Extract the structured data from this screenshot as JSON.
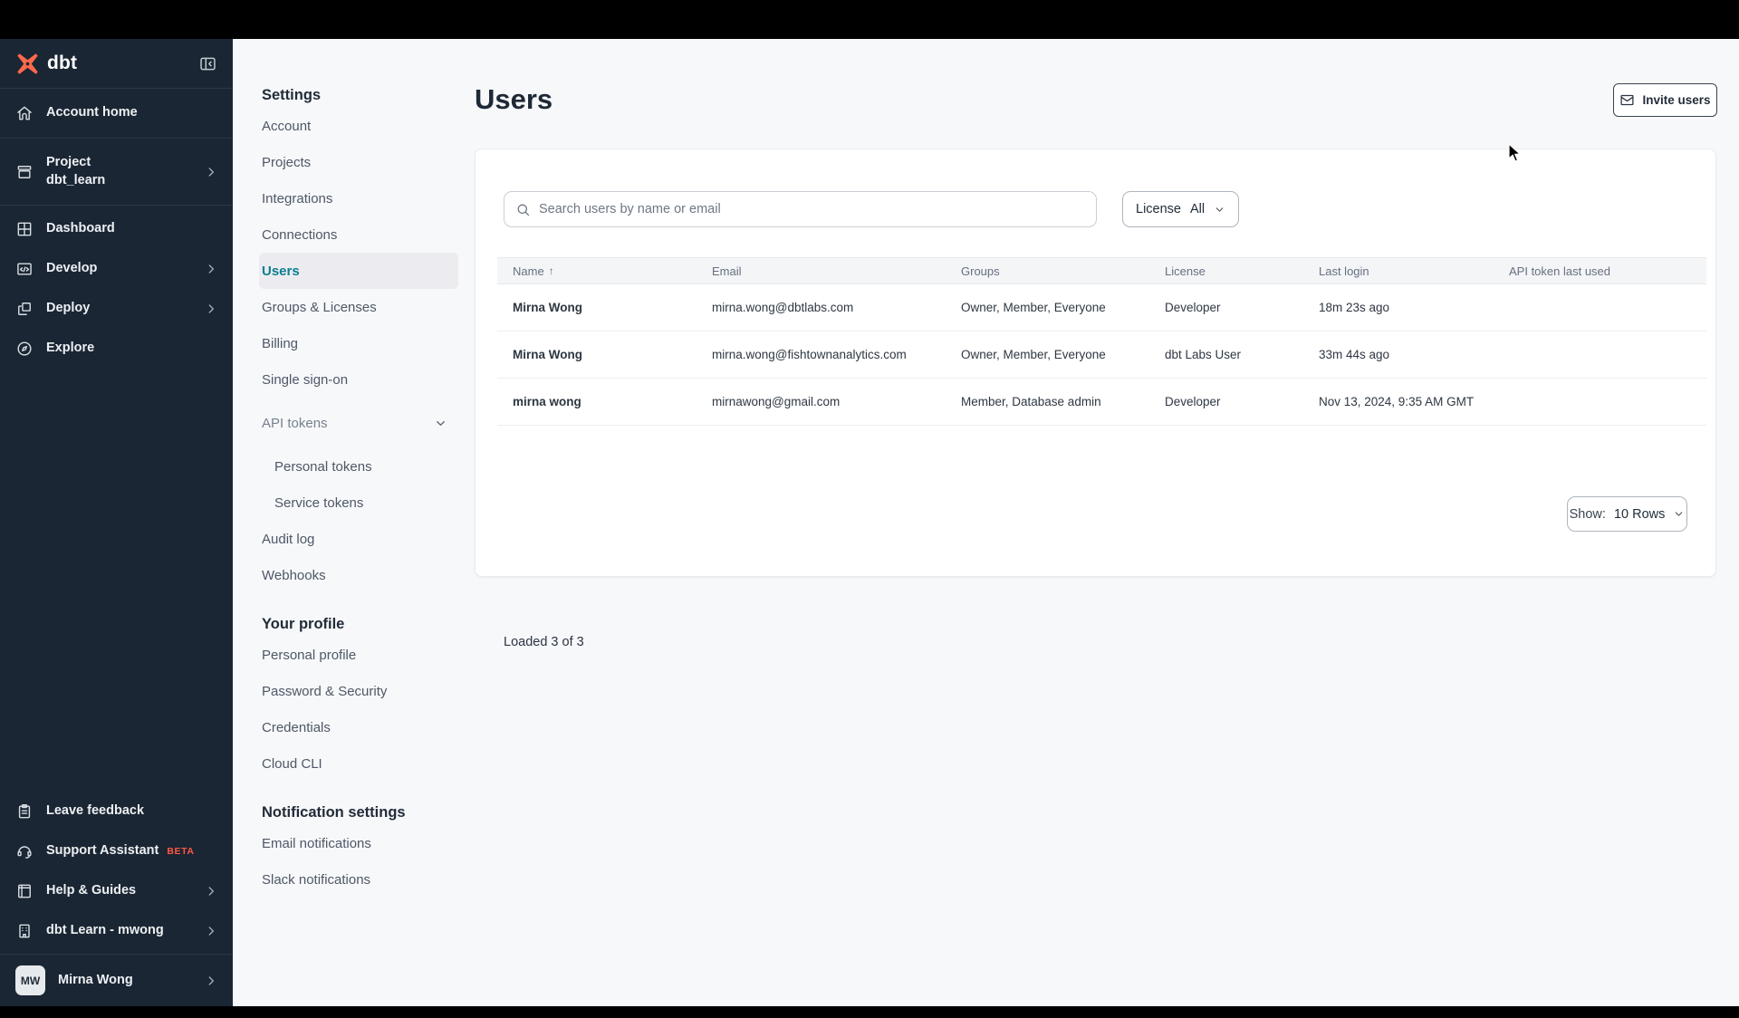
{
  "app": {
    "brand": "dbt"
  },
  "sidebar": {
    "items": [
      {
        "label": "Account home",
        "icon": "home-icon",
        "chevron": false,
        "divider": true,
        "size": "lg"
      },
      {
        "label": "Project",
        "sublabel": "dbt_learn",
        "icon": "project-icon",
        "chevron": true,
        "divider": true,
        "size": "xl"
      },
      {
        "label": "Dashboard",
        "icon": "dashboard-icon",
        "chevron": false
      },
      {
        "label": "Develop",
        "icon": "develop-icon",
        "chevron": true
      },
      {
        "label": "Deploy",
        "icon": "deploy-icon",
        "chevron": true
      },
      {
        "label": "Explore",
        "icon": "explore-icon",
        "chevron": false
      }
    ],
    "footer_items": [
      {
        "label": "Leave feedback",
        "icon": "clipboard-icon",
        "chevron": false
      },
      {
        "label": "Support Assistant",
        "icon": "headset-icon",
        "badge": "BETA",
        "chevron": false
      },
      {
        "label": "Help & Guides",
        "icon": "book-icon",
        "chevron": true
      },
      {
        "label": "dbt Learn - mwong",
        "icon": "building-icon",
        "chevron": true
      }
    ],
    "user": {
      "initials": "MW",
      "name": "Mirna Wong"
    }
  },
  "settings_nav": {
    "sections": [
      {
        "heading": "Settings",
        "items": [
          {
            "label": "Account"
          },
          {
            "label": "Projects"
          },
          {
            "label": "Integrations"
          },
          {
            "label": "Connections"
          },
          {
            "label": "Users",
            "active": true
          },
          {
            "label": "Groups & Licenses"
          },
          {
            "label": "Billing"
          },
          {
            "label": "Single sign-on"
          },
          {
            "label": "API tokens",
            "chevron": true,
            "muted": true,
            "gap": true
          },
          {
            "label": "Personal tokens",
            "indent": true,
            "gap": true
          },
          {
            "label": "Service tokens",
            "indent": true
          },
          {
            "label": "Audit log"
          },
          {
            "label": "Webhooks"
          }
        ]
      },
      {
        "heading": "Your profile",
        "items": [
          {
            "label": "Personal profile"
          },
          {
            "label": "Password & Security"
          },
          {
            "label": "Credentials"
          },
          {
            "label": "Cloud CLI"
          }
        ]
      },
      {
        "heading": "Notification settings",
        "items": [
          {
            "label": "Email notifications"
          },
          {
            "label": "Slack notifications"
          }
        ]
      }
    ]
  },
  "main": {
    "title": "Users",
    "invite_button_label": "Invite users",
    "search_placeholder": "Search users by name or email",
    "license_filter": {
      "label": "License",
      "value": "All"
    },
    "table": {
      "columns": [
        "Name",
        "Email",
        "Groups",
        "License",
        "Last login",
        "API token last used"
      ],
      "sorted_column": "Name",
      "sort_direction": "asc",
      "rows": [
        {
          "name": "Mirna Wong",
          "email": "mirna.wong@dbtlabs.com",
          "groups": "Owner, Member, Everyone",
          "license": "Developer",
          "last_login": "18m 23s ago",
          "api_token_last_used": ""
        },
        {
          "name": "Mirna Wong",
          "email": "mirna.wong@fishtownanalytics.com",
          "groups": "Owner, Member, Everyone",
          "license": "dbt Labs User",
          "last_login": "33m 44s ago",
          "api_token_last_used": ""
        },
        {
          "name": "mirna wong",
          "email": "mirnawong@gmail.com",
          "groups": "Member, Database admin",
          "license": "Developer",
          "last_login": "Nov 13, 2024, 9:35 AM GMT",
          "api_token_last_used": ""
        }
      ]
    },
    "footer": {
      "loaded_text": "Loaded 3 of 3",
      "show_label": "Show:",
      "show_value": "10 Rows"
    }
  },
  "colors": {
    "sidebar_bg": "#1A2633",
    "accent_orange": "#FF694B",
    "beta_badge": "#FF5745",
    "active_teal": "#0C7F8F",
    "topbar": "#000000"
  }
}
